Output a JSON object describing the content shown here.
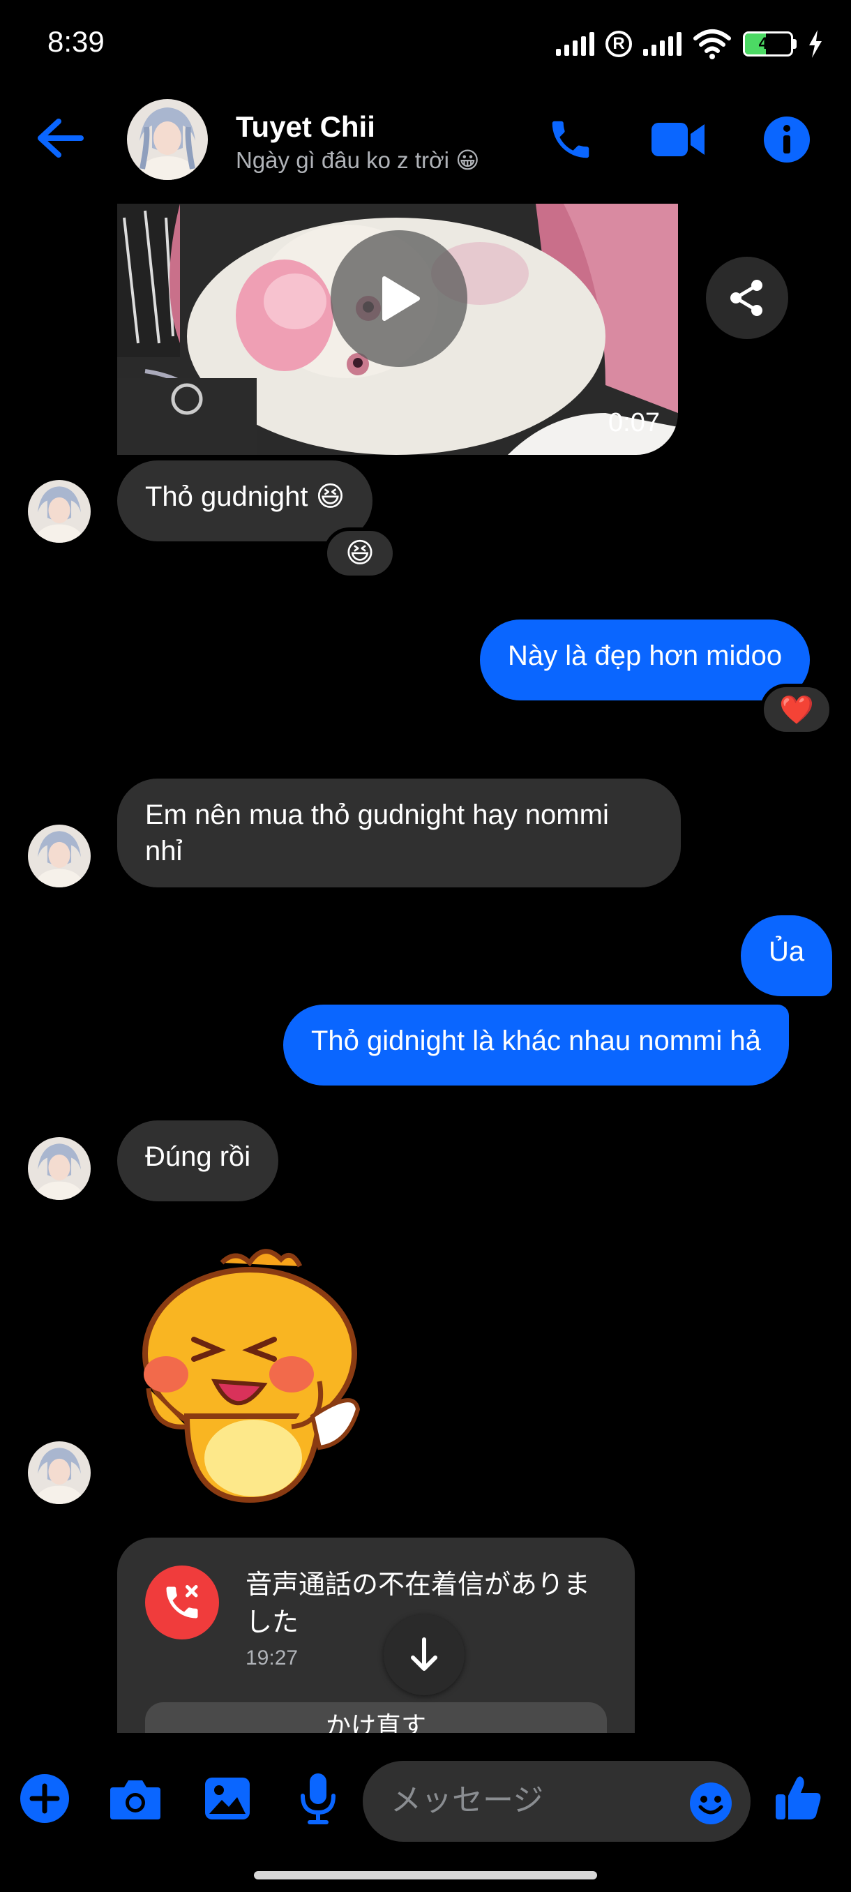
{
  "status_bar": {
    "time": "8:39",
    "battery": "45",
    "battery_level": 0.45
  },
  "header": {
    "name": "Tuyet Chii",
    "status_text": "Ngày gì đâu ko z trời 😀"
  },
  "messages": {
    "video_duration": "0:07",
    "m1_text": "Thỏ gudnight 😆",
    "m1_reaction": "😆",
    "m2_text": "Này là đẹp hơn midoo",
    "m2_reaction": "❤️",
    "m3_text": "Em nên mua thỏ gudnight hay nommi nhỉ",
    "m4_text": "Ủa",
    "m5_text": "Thỏ gidnight là khác nhau nommi hả",
    "m6_text": "Đúng rồi",
    "call_text": "音声通話の不在着信がありました",
    "call_time": "19:27",
    "call_button": "かけ直す"
  },
  "composer": {
    "placeholder": "メッセージ"
  },
  "icons": {
    "back": "back-arrow-icon",
    "phone": "phone-icon",
    "video": "video-camera-icon",
    "info": "info-icon",
    "share": "share-icon",
    "plus": "plus-icon",
    "camera": "camera-icon",
    "gallery": "image-icon",
    "mic": "microphone-icon",
    "emoji": "emoji-icon",
    "like": "thumbs-up-icon"
  },
  "colors": {
    "accent": "#0a66ff",
    "incoming_bubble": "#303030",
    "missed_call": "#f03c3c",
    "background": "#000000"
  }
}
